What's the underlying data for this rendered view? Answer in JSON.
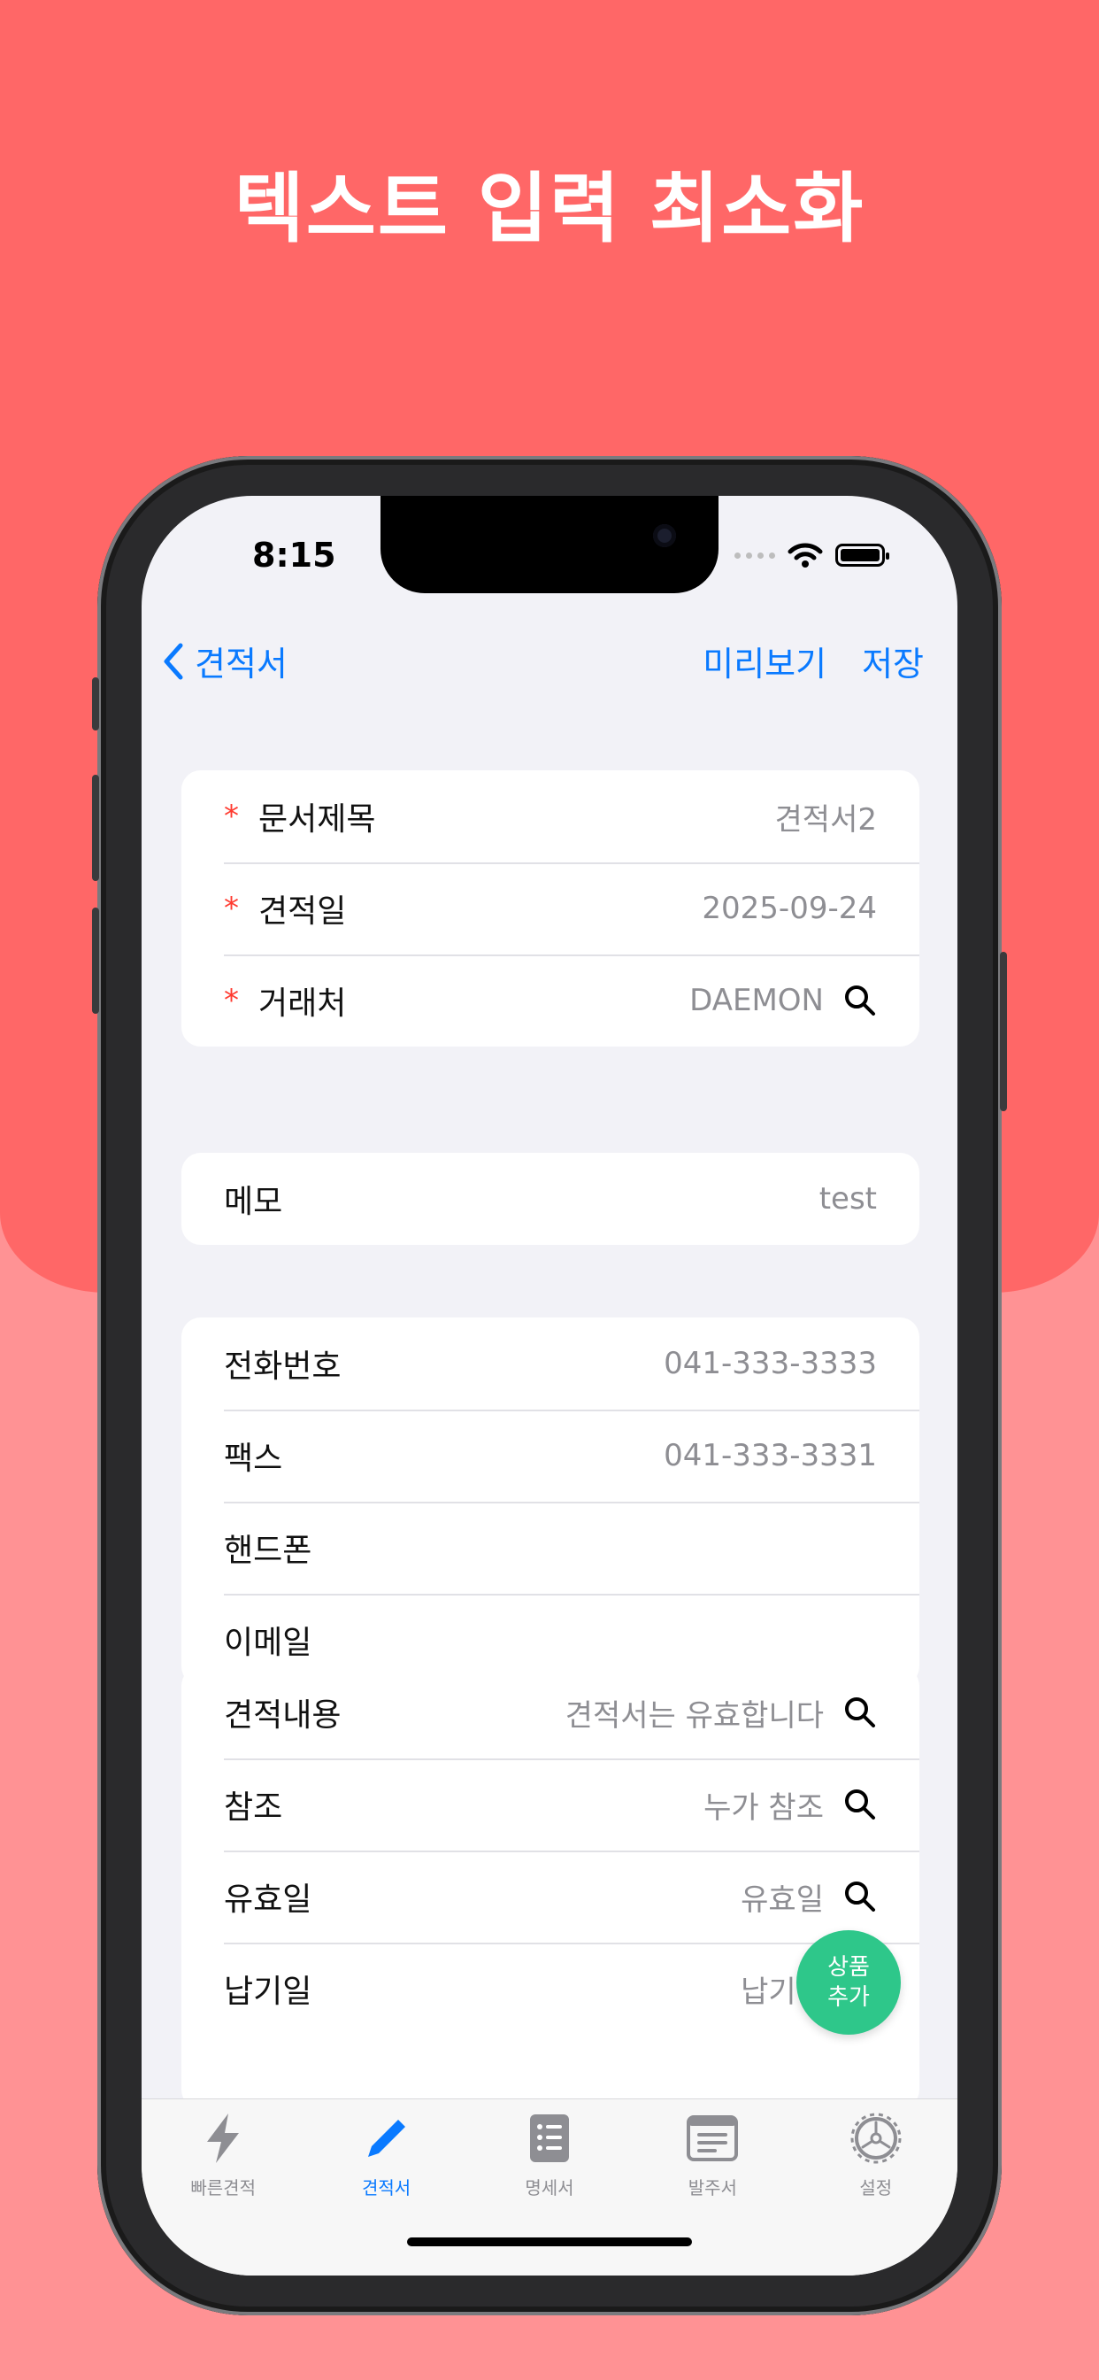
{
  "headline": "텍스트 입력 최소화",
  "status": {
    "time": "8:15"
  },
  "nav": {
    "back_label": "견적서",
    "preview_label": "미리보기",
    "save_label": "저장"
  },
  "section_basic": [
    {
      "label": "문서제목",
      "value": "견적서2",
      "required_mark": "*"
    },
    {
      "label": "견적일",
      "value": "2025-09-24",
      "required_mark": "*"
    },
    {
      "label": "거래처",
      "value": "DAEMON",
      "required_mark": "*"
    }
  ],
  "section_memo": [
    {
      "label": "메모",
      "value": "test"
    }
  ],
  "section_contact": [
    {
      "label": "전화번호",
      "value": "041-333-3333"
    },
    {
      "label": "팩스",
      "value": "041-333-3331"
    },
    {
      "label": "핸드폰",
      "value": ""
    },
    {
      "label": "이메일",
      "value": ""
    }
  ],
  "section_terms": [
    {
      "label": "견적내용",
      "value": "견적서는 유효합니다"
    },
    {
      "label": "참조",
      "value": "누가 참조"
    },
    {
      "label": "유효일",
      "value": "유효일"
    },
    {
      "label": "납기일",
      "value": "납기일"
    }
  ],
  "fab": {
    "line1": "상품",
    "line2": "추가"
  },
  "tabs": [
    {
      "label": "빠른견적",
      "icon": "bolt-icon"
    },
    {
      "label": "견적서",
      "icon": "pencil-icon"
    },
    {
      "label": "명세서",
      "icon": "list-doc-icon"
    },
    {
      "label": "발주서",
      "icon": "form-icon"
    },
    {
      "label": "설정",
      "icon": "gear-icon"
    }
  ],
  "colors": {
    "accent": "#0a7aff",
    "fab": "#2ec78a",
    "required": "#ff3b30",
    "hero_bg": "#ff6767"
  }
}
